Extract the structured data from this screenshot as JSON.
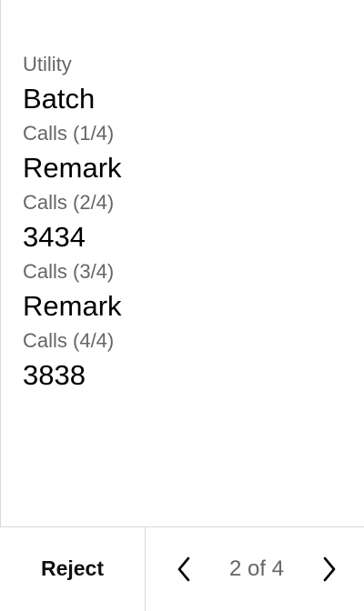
{
  "fields": [
    {
      "label": "Utility",
      "value": "Batch"
    },
    {
      "label": "Calls (1/4)",
      "value": "Remark"
    },
    {
      "label": "Calls (2/4)",
      "value": "3434"
    },
    {
      "label": "Calls (3/4)",
      "value": "Remark"
    },
    {
      "label": "Calls (4/4)",
      "value": "3838"
    }
  ],
  "footer": {
    "reject_label": "Reject",
    "page_indicator": "2 of 4",
    "prev_icon": "chevron-left-icon",
    "next_icon": "chevron-right-icon"
  },
  "colors": {
    "label": "#666666",
    "value": "#000000",
    "divider": "#d9d9d9"
  }
}
